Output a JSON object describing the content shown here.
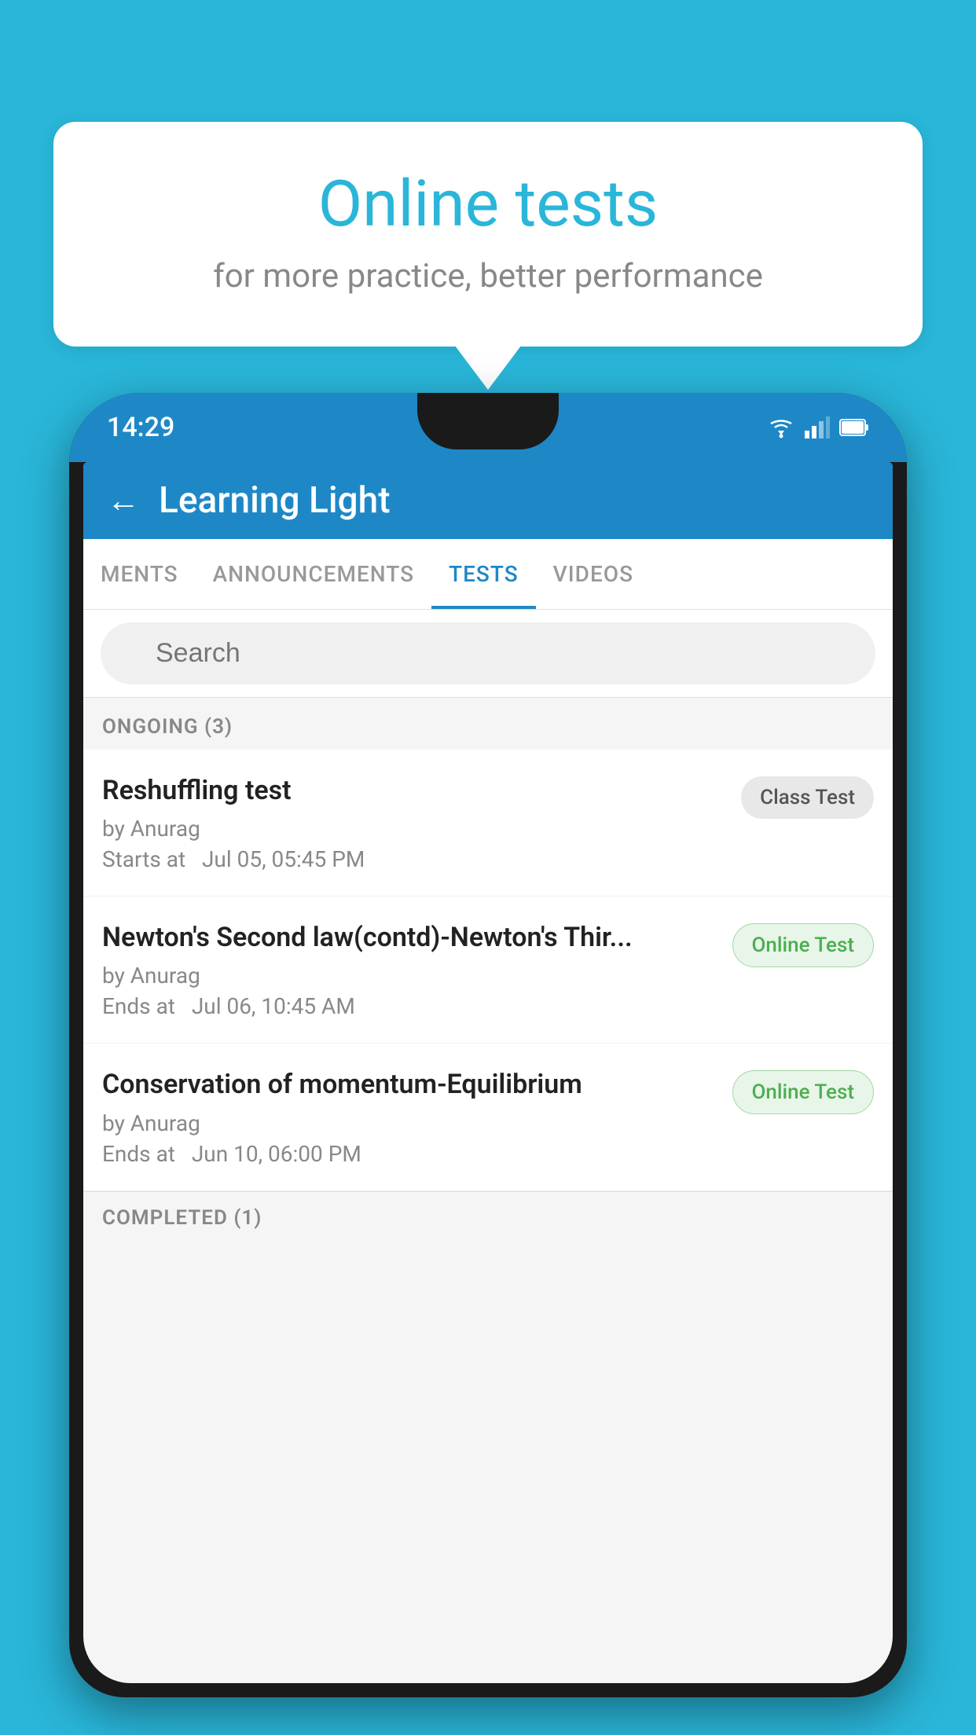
{
  "background_color": "#29b6d9",
  "speech_bubble": {
    "title": "Online tests",
    "subtitle": "for more practice, better performance"
  },
  "phone": {
    "status_bar": {
      "time": "14:29"
    },
    "app_header": {
      "title": "Learning Light",
      "back_label": "←"
    },
    "tabs": [
      {
        "label": "MENTS",
        "active": false
      },
      {
        "label": "ANNOUNCEMENTS",
        "active": false
      },
      {
        "label": "TESTS",
        "active": true
      },
      {
        "label": "VIDEOS",
        "active": false
      }
    ],
    "search": {
      "placeholder": "Search"
    },
    "ongoing_section": {
      "header": "ONGOING (3)",
      "items": [
        {
          "name": "Reshuffling test",
          "author": "by Anurag",
          "date_label": "Starts at",
          "date": "Jul 05, 05:45 PM",
          "badge": "Class Test",
          "badge_type": "class"
        },
        {
          "name": "Newton's Second law(contd)-Newton's Thir...",
          "author": "by Anurag",
          "date_label": "Ends at",
          "date": "Jul 06, 10:45 AM",
          "badge": "Online Test",
          "badge_type": "online"
        },
        {
          "name": "Conservation of momentum-Equilibrium",
          "author": "by Anurag",
          "date_label": "Ends at",
          "date": "Jun 10, 06:00 PM",
          "badge": "Online Test",
          "badge_type": "online"
        }
      ]
    },
    "completed_section": {
      "header": "COMPLETED (1)"
    }
  }
}
